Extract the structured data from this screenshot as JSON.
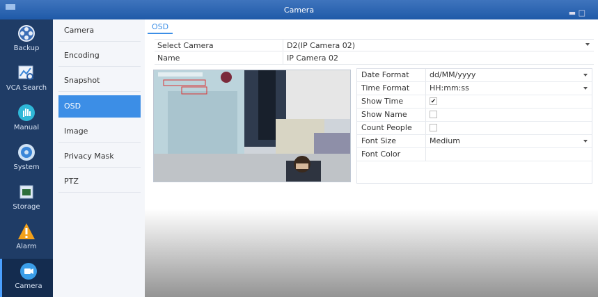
{
  "window": {
    "title": "Camera"
  },
  "leftnav": {
    "items": [
      {
        "label": "Backup",
        "icon": "film-reel-icon"
      },
      {
        "label": "VCA Search",
        "icon": "chart-search-icon"
      },
      {
        "label": "Manual",
        "icon": "hand-icon"
      },
      {
        "label": "System",
        "icon": "gear-icon"
      },
      {
        "label": "Storage",
        "icon": "storage-icon"
      },
      {
        "label": "Alarm",
        "icon": "warning-icon"
      },
      {
        "label": "Camera",
        "icon": "camera-icon",
        "active": true
      }
    ]
  },
  "subnav": {
    "items": [
      {
        "label": "Camera"
      },
      {
        "label": "Encoding"
      },
      {
        "label": "Snapshot"
      },
      {
        "label": "OSD",
        "active": true
      },
      {
        "label": "Image"
      },
      {
        "label": "Privacy Mask"
      },
      {
        "label": "PTZ"
      }
    ]
  },
  "main": {
    "tab": "OSD",
    "select_camera": {
      "label": "Select Camera",
      "value": "D2(IP Camera 02)"
    },
    "name": {
      "label": "Name",
      "value": "IP Camera 02"
    }
  },
  "osd": {
    "date_format": {
      "label": "Date Format",
      "value": "dd/MM/yyyy"
    },
    "time_format": {
      "label": "Time Format",
      "value": "HH:mm:ss"
    },
    "show_time": {
      "label": "Show Time",
      "checked": true,
      "mark": "✔"
    },
    "show_name": {
      "label": "Show Name",
      "checked": false
    },
    "count_people": {
      "label": "Count People",
      "checked": false
    },
    "font_size": {
      "label": "Font Size",
      "value": "Medium"
    },
    "font_color": {
      "label": "Font Color",
      "value": ""
    }
  },
  "colors": {
    "accent": "#3c8ee6",
    "nav_bg": "#1f3c66",
    "title_bar": "#2c66b4"
  }
}
